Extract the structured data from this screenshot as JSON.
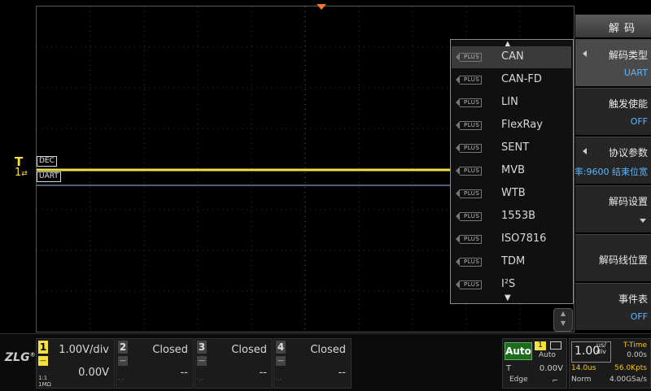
{
  "waveform": {
    "channel_marker_label": "1",
    "trigger_marker_label": "T",
    "decode_tag": "DEC",
    "bus_tag": "UART"
  },
  "protocol_list": {
    "badge": "PLUS",
    "items": [
      "CAN",
      "CAN-FD",
      "LIN",
      "FlexRay",
      "SENT",
      "MVB",
      "WTB",
      "1553B",
      "ISO7816",
      "TDM",
      "I²S"
    ],
    "selected_index": 0
  },
  "menu": {
    "title": "解码",
    "items": [
      {
        "label": "解码类型",
        "value": "UART"
      },
      {
        "label": "触发使能",
        "value": "OFF"
      },
      {
        "label": "协议参数",
        "value": "率:9600 结束位宽"
      },
      {
        "label": "解码设置",
        "value": ""
      },
      {
        "label": "解码线位置",
        "value": ""
      },
      {
        "label": "事件表",
        "value": "OFF"
      }
    ]
  },
  "bottom": {
    "logo": "ZLG",
    "logo_mark": "®",
    "channels": [
      {
        "num": "1",
        "scale": "1.00V/div",
        "offset": "0.00V",
        "probe": "1:1",
        "impedance": "1MΩ",
        "coupling": "—"
      },
      {
        "num": "2",
        "scale": "Closed",
        "offset": "--",
        "probe": "-.-",
        "coupling": "—"
      },
      {
        "num": "3",
        "scale": "Closed",
        "offset": "--",
        "probe": "-.-",
        "coupling": "—"
      },
      {
        "num": "4",
        "scale": "Closed",
        "offset": "--",
        "probe": "-.-",
        "coupling": "—"
      }
    ],
    "trigger": {
      "mode": "Auto",
      "source": "1",
      "sweep": "Auto",
      "t_label": "T",
      "level": "0.00V",
      "type": "Edge",
      "slope": "⌐"
    },
    "timebase": {
      "value": "1.00",
      "unit_top": "us/",
      "unit_bottom": "div",
      "t_time_label": "T-Time",
      "t_time_value": "0.00s",
      "hpos": "14.0us",
      "memory": "56.0Kpts",
      "acq_mode": "Norm",
      "sample_rate": "4.00GSa/s"
    }
  },
  "colors": {
    "ch1": "#f5e042",
    "trigger_marker": "#f07a2a",
    "bus_line": "#9fc3ff",
    "auto_green": "#1e6b1e",
    "menu_value_blue": "#5bb5ff"
  }
}
